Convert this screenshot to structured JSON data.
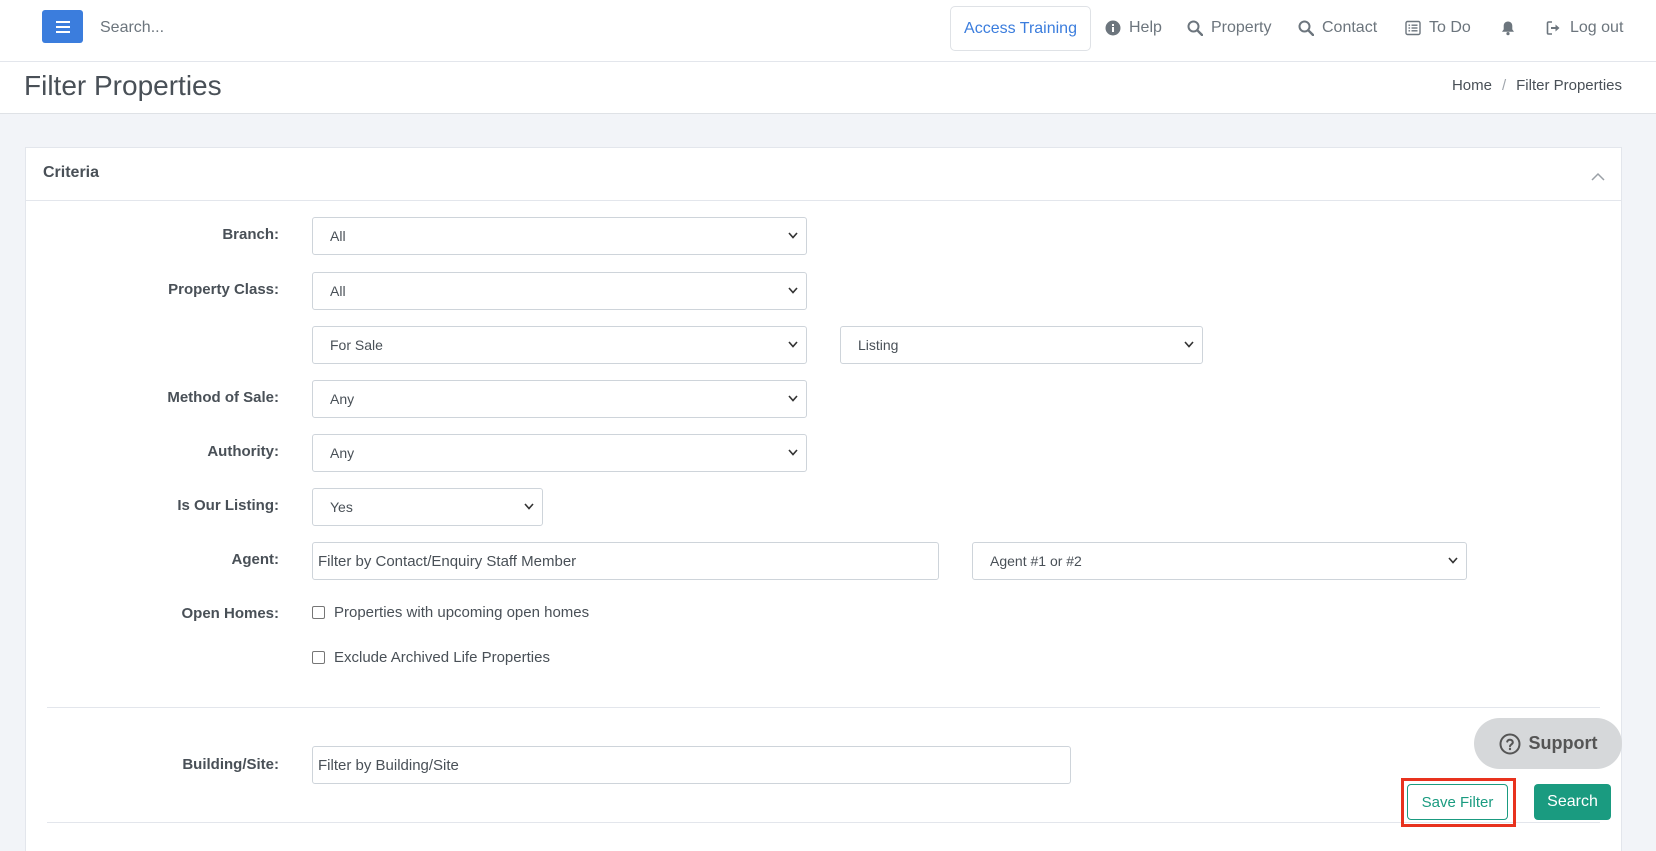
{
  "topnav": {
    "search_placeholder": "Search...",
    "access_training": "Access Training",
    "help": "Help",
    "property": "Property",
    "contact": "Contact",
    "todo": "To Do",
    "logout": "Log out"
  },
  "header": {
    "title": "Filter Properties",
    "breadcrumb": [
      "Home",
      "Filter Properties"
    ]
  },
  "criteria": {
    "title": "Criteria",
    "branch_label": "Branch:",
    "branch_value": "All",
    "property_class_label": "Property Class:",
    "property_class_value": "All",
    "sale_type_value": "For Sale",
    "listing_value": "Listing",
    "method_label": "Method of Sale:",
    "method_value": "Any",
    "authority_label": "Authority:",
    "authority_value": "Any",
    "our_listing_label": "Is Our Listing:",
    "our_listing_value": "Yes",
    "agent_label": "Agent:",
    "agent_placeholder": "Filter by Contact/Enquiry Staff Member",
    "agent_role_value": "Agent #1 or #2",
    "open_homes_label": "Open Homes:",
    "open_homes_checkbox": "Properties with upcoming open homes",
    "exclude_archived_checkbox": "Exclude Archived Life Properties",
    "building_label": "Building/Site:",
    "building_placeholder": "Filter by Building/Site"
  },
  "actions": {
    "support": "Support",
    "save_filter": "Save Filter",
    "search": "Search"
  },
  "colors": {
    "primary": "#3b7ddd",
    "success": "#1a9b80",
    "highlight": "#e8321e"
  }
}
